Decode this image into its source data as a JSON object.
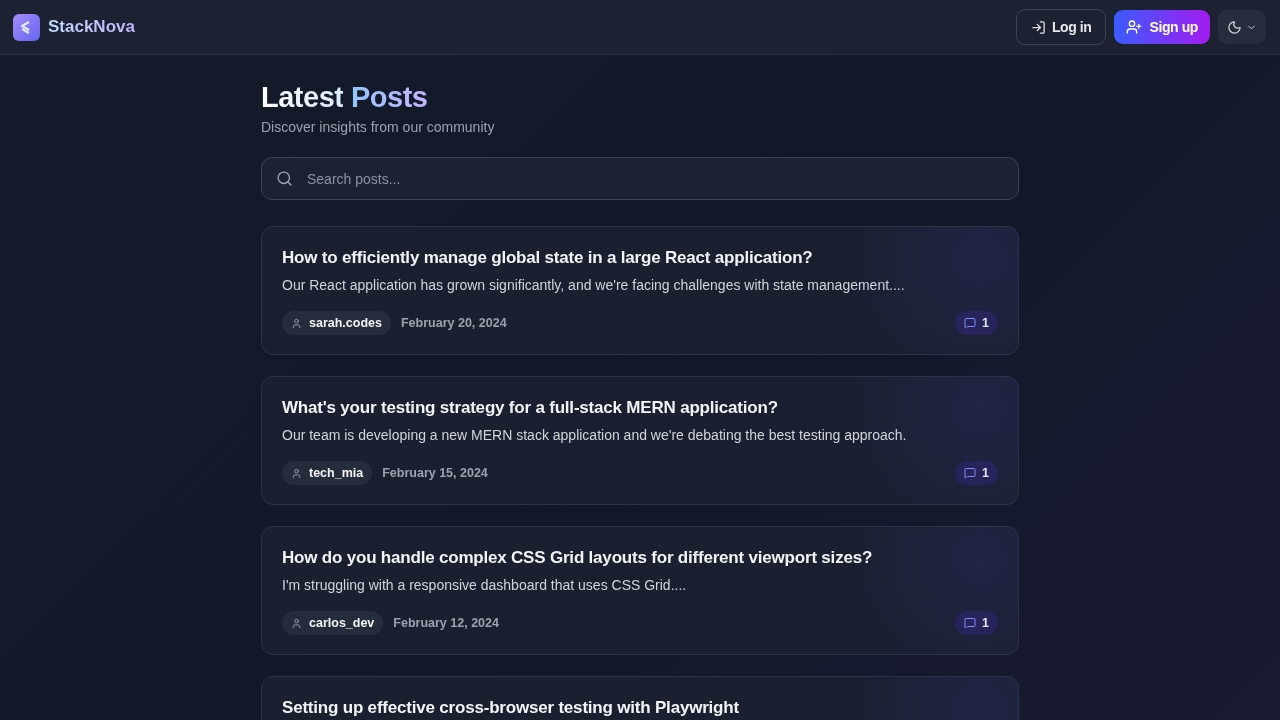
{
  "brand": {
    "name": "StackNova"
  },
  "nav": {
    "login": "Log in",
    "signup": "Sign up"
  },
  "heading": {
    "text": "Latest",
    "accent": "Posts",
    "subtitle": "Discover insights from our community"
  },
  "search": {
    "placeholder": "Search posts..."
  },
  "posts": [
    {
      "title": "How to efficiently manage global state in a large React application?",
      "excerpt": "Our React application has grown significantly, and we're facing challenges with state management....",
      "author": "sarah.codes",
      "date": "February 20, 2024",
      "comments": "1"
    },
    {
      "title": "What's your testing strategy for a full-stack MERN application?",
      "excerpt": "Our team is developing a new MERN stack application and we're debating the best testing approach.",
      "author": "tech_mia",
      "date": "February 15, 2024",
      "comments": "1"
    },
    {
      "title": "How do you handle complex CSS Grid layouts for different viewport sizes?",
      "excerpt": "I'm struggling with a responsive dashboard that uses CSS Grid....",
      "author": "carlos_dev",
      "date": "February 12, 2024",
      "comments": "1"
    },
    {
      "title": "Setting up effective cross-browser testing with Playwright"
    }
  ]
}
